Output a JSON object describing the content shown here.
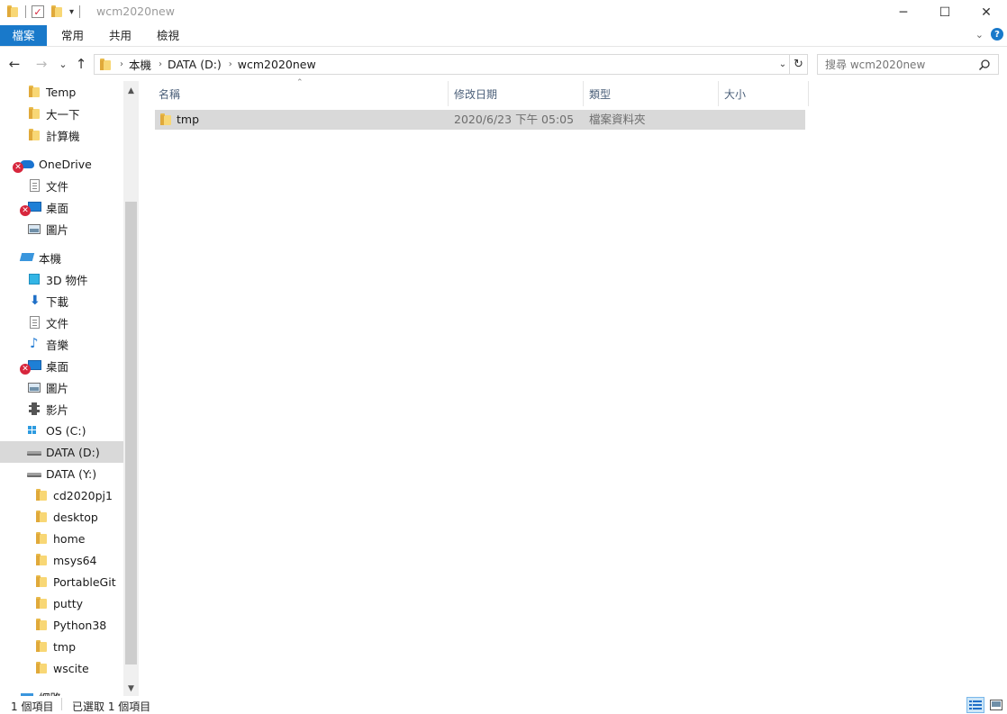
{
  "window": {
    "title": "wcm2020new",
    "controls": {
      "minimize": "─",
      "maximize": "☐",
      "close": "✕"
    }
  },
  "ribbon": {
    "tabs": [
      {
        "label": "檔案"
      },
      {
        "label": "常用"
      },
      {
        "label": "共用"
      },
      {
        "label": "檢視"
      }
    ]
  },
  "nav": {
    "back": "←",
    "forward": "→",
    "recent": "⌄",
    "up": "↑",
    "breadcrumbs": [
      "本機",
      "DATA (D:)",
      "wcm2020new"
    ],
    "search_placeholder": "搜尋 wcm2020new"
  },
  "tree": [
    {
      "label": "Temp",
      "icon": "folder-icon"
    },
    {
      "label": "大一下",
      "icon": "folder-icon"
    },
    {
      "label": "計算機",
      "icon": "folder-icon"
    },
    {
      "label": "OneDrive",
      "icon": "onedrive-icon",
      "badge": "error"
    },
    {
      "label": "文件",
      "icon": "document-icon"
    },
    {
      "label": "桌面",
      "icon": "desktop-icon",
      "badge": "error"
    },
    {
      "label": "圖片",
      "icon": "pictures-icon"
    },
    {
      "label": "本機",
      "icon": "this-pc-icon"
    },
    {
      "label": "3D 物件",
      "icon": "3d-objects-icon"
    },
    {
      "label": "下載",
      "icon": "downloads-icon"
    },
    {
      "label": "文件",
      "icon": "document-icon"
    },
    {
      "label": "音樂",
      "icon": "music-icon"
    },
    {
      "label": "桌面",
      "icon": "desktop-icon",
      "badge": "error"
    },
    {
      "label": "圖片",
      "icon": "pictures-icon"
    },
    {
      "label": "影片",
      "icon": "videos-icon"
    },
    {
      "label": "OS (C:)",
      "icon": "os-drive-icon"
    },
    {
      "label": "DATA (D:)",
      "icon": "drive-icon",
      "selected": true
    },
    {
      "label": "DATA (Y:)",
      "icon": "drive-icon"
    },
    {
      "label": "cd2020pj1",
      "icon": "folder-icon"
    },
    {
      "label": "desktop",
      "icon": "folder-icon"
    },
    {
      "label": "home",
      "icon": "folder-icon"
    },
    {
      "label": "msys64",
      "icon": "folder-icon"
    },
    {
      "label": "PortableGit",
      "icon": "folder-icon"
    },
    {
      "label": "putty",
      "icon": "folder-icon"
    },
    {
      "label": "Python38",
      "icon": "folder-icon"
    },
    {
      "label": "tmp",
      "icon": "folder-icon"
    },
    {
      "label": "wscite",
      "icon": "folder-icon"
    },
    {
      "label": "網路",
      "icon": "network-icon"
    }
  ],
  "columns": [
    {
      "label": "名稱"
    },
    {
      "label": "修改日期"
    },
    {
      "label": "類型"
    },
    {
      "label": "大小"
    }
  ],
  "files": [
    {
      "name": "tmp",
      "modified": "2020/6/23 下午 05:05",
      "type": "檔案資料夾",
      "size": ""
    }
  ],
  "status": {
    "item_count": "1 個項目",
    "selected": "已選取 1 個項目"
  },
  "colors": {
    "accent": "#1979ca",
    "selection": "#d9d9d9",
    "error_badge": "#d7263d"
  }
}
